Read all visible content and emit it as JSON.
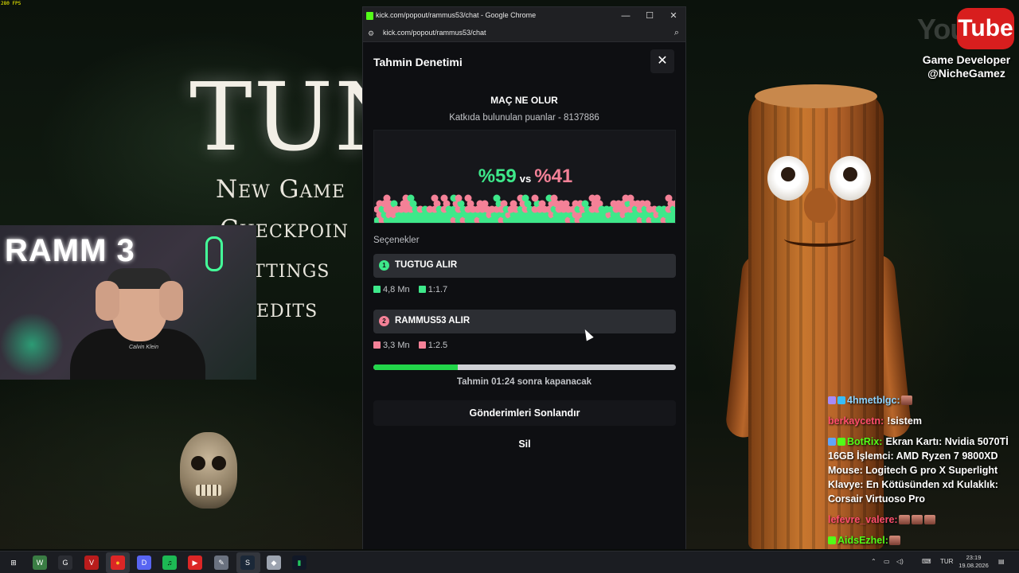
{
  "game": {
    "fps": "280 FPS",
    "title": "TUN",
    "menu": [
      "New Game",
      "Checkpoin",
      "ttings",
      "edits"
    ]
  },
  "youtube": {
    "word": "You",
    "tube": "Tube",
    "line1": "Game Developer",
    "line2": "@NicheGamez"
  },
  "webcam": {
    "sign_text": "RAMM    3",
    "shirt_text": "Calvin Klein"
  },
  "chrome": {
    "window_title": "kick.com/popout/rammus53/chat - Google Chrome",
    "url": "kick.com/popout/rammus53/chat",
    "minimize": "—",
    "maximize": "☐",
    "close": "✕"
  },
  "prediction": {
    "panel_title": "Tahmin Denetimi",
    "close_label": "✕",
    "question": "MAÇ NE OLUR",
    "points_text": "Katkıda bulunulan puanlar - 8137886",
    "percent_a": "%59",
    "vs": "vs",
    "percent_b": "%41",
    "options_label": "Seçenekler",
    "options": [
      {
        "index": "1",
        "label": "TUGTUG ALIR",
        "amount": "4,8 Mn",
        "ratio": "1:1.7",
        "color": "#3ee88a"
      },
      {
        "index": "2",
        "label": "RAMMUS53 ALIR",
        "amount": "3,3 Mn",
        "ratio": "1:2.5",
        "color": "#f48197"
      }
    ],
    "time_remaining_fraction": 0.28,
    "closing_text": "Tahmin 01:24 sonra kapanacak",
    "end_button": "Gönderimleri Sonlandır",
    "delete_button": "Sil",
    "colors": {
      "green": "#3ee88a",
      "pink": "#f48197",
      "progress": "#22d64a"
    }
  },
  "chat": [
    {
      "user": "4hmetblgc:",
      "text": "",
      "user_color": "#8fd4ff",
      "emotes": 1,
      "badges": [
        "#a78bfa",
        "#38bdf8"
      ]
    },
    {
      "user": "berkaycetn:",
      "text": "!sistem",
      "user_color": "#ff4d6d",
      "emotes": 0,
      "badges": []
    },
    {
      "user": "BotRix:",
      "text": "Ekran Kartı: Nvidia 5070Tİ 16GB İşlemci: AMD Ryzen 7 9800XD Mouse: Logitech G pro X Superlight Klavye: En Kötüsünden xd Kulaklık: Corsair Virtuoso Pro",
      "user_color": "#53fc18",
      "emotes": 0,
      "badges": [
        "#60a5fa",
        "#53fc18"
      ]
    },
    {
      "user": "lefevre_valere:",
      "text": "",
      "user_color": "#ff4d6d",
      "emotes": 3,
      "badges": []
    },
    {
      "user": "AidsEzhel:",
      "text": "",
      "user_color": "#53fc18",
      "emotes": 1,
      "badges": [
        "#53fc18"
      ]
    }
  ],
  "taskbar": {
    "icons": [
      {
        "name": "windows-start-icon",
        "glyph": "⊞",
        "color": "#ffffff",
        "bg": "transparent"
      },
      {
        "name": "app-icon-1",
        "glyph": "W",
        "color": "#ffffff",
        "bg": "#3a7d44"
      },
      {
        "name": "app-icon-2",
        "glyph": "G",
        "color": "#ffffff",
        "bg": "#2b2d33"
      },
      {
        "name": "voicemeeter-icon",
        "glyph": "V",
        "color": "#ffffff",
        "bg": "#b91c1c"
      },
      {
        "name": "chrome-icon",
        "glyph": "●",
        "color": "#fbbf24",
        "bg": "#dc2626"
      },
      {
        "name": "discord-icon",
        "glyph": "D",
        "color": "#ffffff",
        "bg": "#5865f2"
      },
      {
        "name": "spotify-icon",
        "glyph": "♫",
        "color": "#000000",
        "bg": "#1db954"
      },
      {
        "name": "youtube-icon",
        "glyph": "▶",
        "color": "#ffffff",
        "bg": "#dc2626"
      },
      {
        "name": "app-icon-3",
        "glyph": "✎",
        "color": "#ffffff",
        "bg": "#6b7280"
      },
      {
        "name": "steam-icon",
        "glyph": "S",
        "color": "#ffffff",
        "bg": "#1b2838"
      },
      {
        "name": "app-icon-4",
        "glyph": "◆",
        "color": "#ffffff",
        "bg": "#9ca3af"
      },
      {
        "name": "app-icon-5",
        "glyph": "▮",
        "color": "#22c55e",
        "bg": "#111827"
      }
    ],
    "language": "TUR",
    "time": "23:19",
    "date": "19.08.2026"
  }
}
